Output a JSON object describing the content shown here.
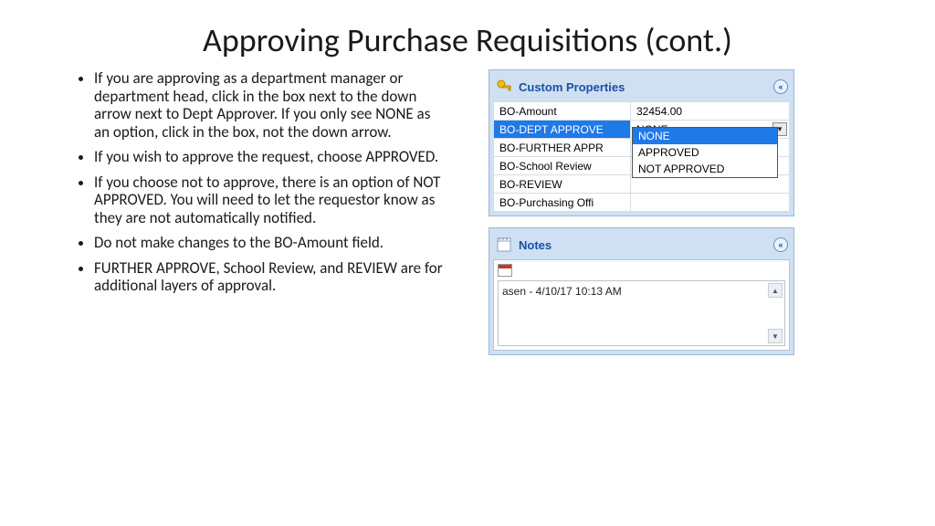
{
  "title": "Approving Purchase Requisitions (cont.)",
  "bullets": [
    "If you are approving as a department manager or department head, click in the box next to the down arrow next to Dept Approver. If you only see NONE as an option, click in the box, not the down arrow.",
    "If you wish to approve the request, choose APPROVED.",
    "If you choose not to approve, there is an option of NOT APPROVED. You will need to let the requestor know as they are not automatically notified.",
    "Do not make changes to the BO-Amount field.",
    "FURTHER APPROVE, School Review, and REVIEW are for additional layers of approval."
  ],
  "panels": {
    "custom": {
      "title": "Custom Properties",
      "rows": [
        {
          "label": "BO-Amount",
          "value": "32454.00"
        },
        {
          "label": "BO-DEPT APPROVE",
          "value": "NONE"
        },
        {
          "label": "BO-FURTHER APPR",
          "value": ""
        },
        {
          "label": "BO-School Review",
          "value": ""
        },
        {
          "label": "BO-REVIEW",
          "value": ""
        },
        {
          "label": "BO-Purchasing Offi",
          "value": ""
        }
      ],
      "dropdown": [
        "NONE",
        "APPROVED",
        "NOT APPROVED"
      ]
    },
    "notes": {
      "title": "Notes",
      "entry": "asen - 4/10/17 10:13 AM"
    }
  }
}
